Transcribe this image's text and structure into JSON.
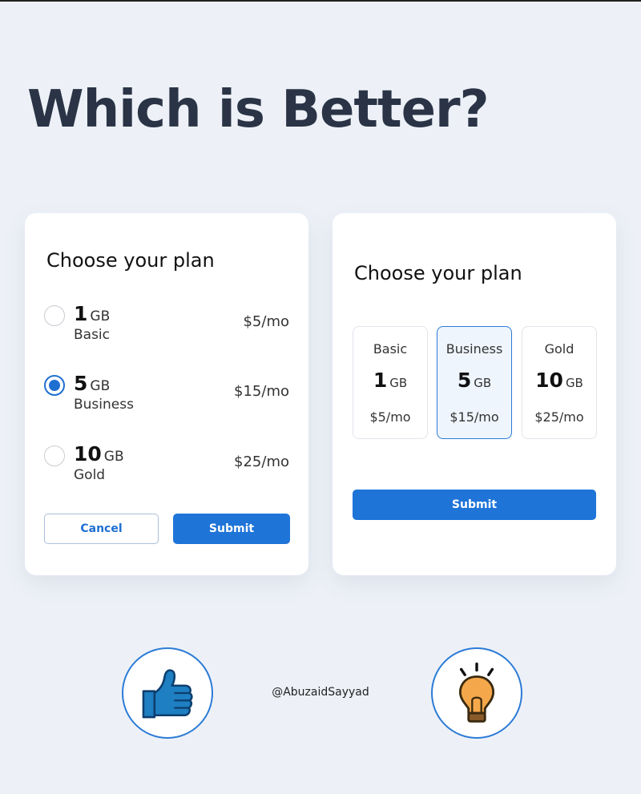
{
  "headline": "Which is Better?",
  "left_card": {
    "title": "Choose your plan",
    "options": [
      {
        "size": "1",
        "unit": "GB",
        "name": "Basic",
        "price": "$5/mo",
        "selected": false
      },
      {
        "size": "5",
        "unit": "GB",
        "name": "Business",
        "price": "$15/mo",
        "selected": true
      },
      {
        "size": "10",
        "unit": "GB",
        "name": "Gold",
        "price": "$25/mo",
        "selected": false
      }
    ],
    "cancel_label": "Cancel",
    "submit_label": "Submit"
  },
  "right_card": {
    "title": "Choose your plan",
    "tiles": [
      {
        "name": "Basic",
        "size": "1",
        "unit": "GB",
        "price": "$5/mo",
        "selected": false
      },
      {
        "name": "Business",
        "size": "5",
        "unit": "GB",
        "price": "$15/mo",
        "selected": true
      },
      {
        "name": "Gold",
        "size": "10",
        "unit": "GB",
        "price": "$25/mo",
        "selected": false
      }
    ],
    "submit_label": "Submit"
  },
  "footer": {
    "handle": "@AbuzaidSayyad",
    "left_icon": "thumbs-up-icon",
    "right_icon": "lightbulb-icon"
  },
  "colors": {
    "background": "#edf1f7",
    "accent": "#1f74d8",
    "headline": "#2a3446"
  }
}
